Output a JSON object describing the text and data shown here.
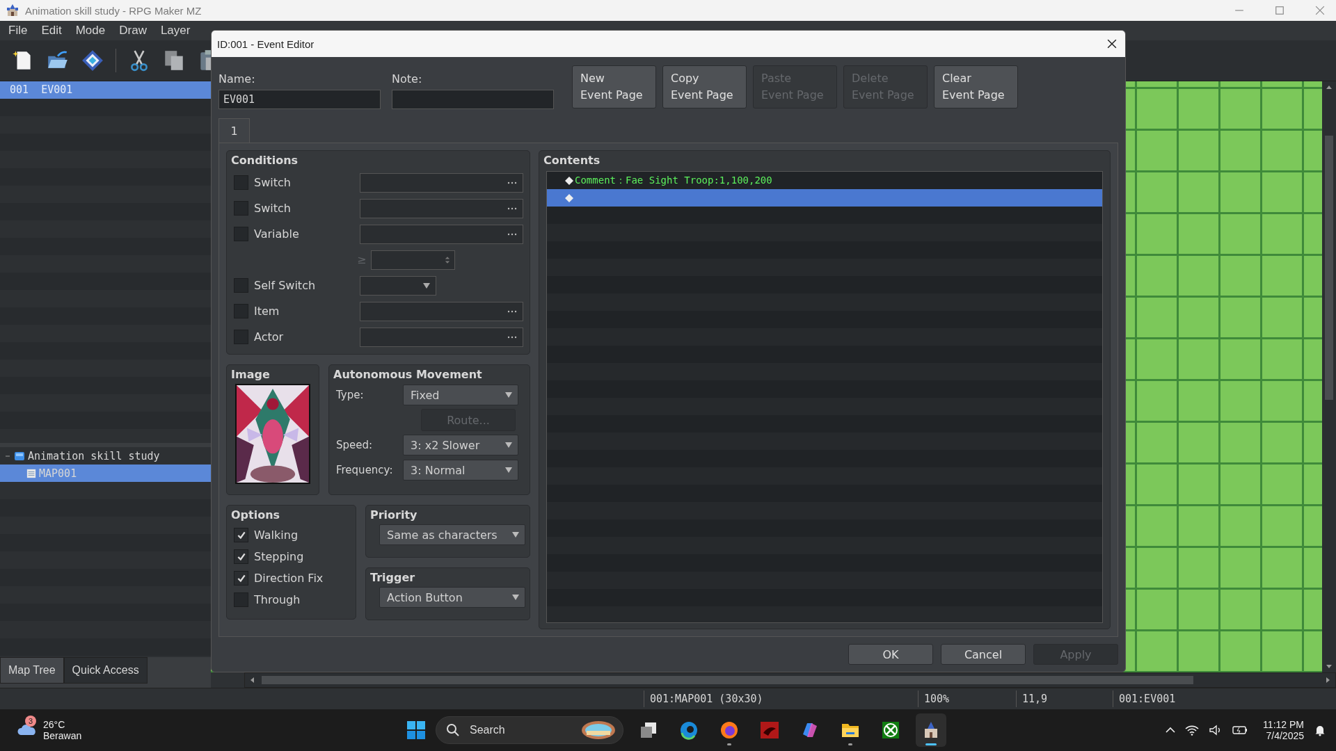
{
  "window": {
    "title": "Animation skill study - RPG Maker MZ"
  },
  "menu": [
    "File",
    "Edit",
    "Mode",
    "Draw",
    "Layer"
  ],
  "event_list": [
    {
      "label": "001  EV001",
      "selected": true
    }
  ],
  "map_tree": [
    {
      "label": "Animation skill study",
      "expanded": true,
      "selected": false,
      "children": [
        {
          "label": "MAP001",
          "selected": true
        }
      ]
    }
  ],
  "panel_tabs": [
    {
      "label": "Map Tree",
      "selected": true
    },
    {
      "label": "Quick Access",
      "selected": false
    }
  ],
  "status_bar": [
    "001:MAP001 (30x30)",
    "100%",
    "11,9",
    "001:EV001"
  ],
  "dialog": {
    "title": "ID:001 - Event Editor",
    "name_label": "Name:",
    "name_value": "EV001",
    "note_label": "Note:",
    "page_buttons": [
      {
        "lines": [
          "New",
          "Event Page"
        ],
        "disabled": false
      },
      {
        "lines": [
          "Copy",
          "Event Page"
        ],
        "disabled": false
      },
      {
        "lines": [
          "Paste",
          "Event Page"
        ],
        "disabled": true
      },
      {
        "lines": [
          "Delete",
          "Event Page"
        ],
        "disabled": true
      },
      {
        "lines": [
          "Clear",
          "Event Page"
        ],
        "disabled": false
      }
    ],
    "page_tabs": [
      {
        "label": "1",
        "selected": true
      }
    ],
    "conditions": {
      "title": "Conditions",
      "rows": [
        {
          "kind": "ref",
          "label": "Switch",
          "checked": false
        },
        {
          "kind": "ref",
          "label": "Switch",
          "checked": false
        },
        {
          "kind": "ref",
          "label": "Variable",
          "checked": false
        },
        {
          "kind": "compare",
          "symbol": "≥"
        },
        {
          "kind": "choice",
          "label": "Self Switch",
          "checked": false
        },
        {
          "kind": "ref",
          "label": "Item",
          "checked": false
        },
        {
          "kind": "ref",
          "label": "Actor",
          "checked": false
        }
      ]
    },
    "image": {
      "title": "Image",
      "kind": "picture"
    },
    "movement": {
      "title": "Autonomous Movement",
      "fields": [
        {
          "kind": "dropdown",
          "label": "Type:",
          "value": "Fixed"
        },
        {
          "kind": "button",
          "label": "Route...",
          "disabled": true
        },
        {
          "kind": "dropdown",
          "label": "Speed:",
          "value": "3: x2 Slower"
        },
        {
          "kind": "dropdown",
          "label": "Frequency:",
          "value": "3: Normal"
        }
      ]
    },
    "options": {
      "title": "Options",
      "items": [
        {
          "label": "Walking",
          "checked": true
        },
        {
          "label": "Stepping",
          "checked": true
        },
        {
          "label": "Direction Fix",
          "checked": true
        },
        {
          "label": "Through",
          "checked": false
        }
      ]
    },
    "priority": {
      "title": "Priority",
      "value": "Same as characters"
    },
    "trigger": {
      "title": "Trigger",
      "value": "Action Button"
    },
    "contents": {
      "title": "Contents",
      "lines": [
        {
          "text": "Comment：Fae Sight Troop:1,100,200",
          "selected": false
        },
        {
          "selected": true
        }
      ]
    },
    "buttons": [
      {
        "label": "OK",
        "disabled": false
      },
      {
        "label": "Cancel",
        "disabled": false
      },
      {
        "label": "Apply",
        "disabled": true
      }
    ]
  },
  "taskbar": {
    "weather": {
      "badge": "3",
      "temperature": "26°C",
      "condition": "Berawan"
    },
    "search": {
      "placeholder": "Search"
    },
    "apps": [
      {
        "running": false,
        "focused": false
      },
      {
        "running": false,
        "focused": false
      },
      {
        "running": true,
        "focused": false
      },
      {
        "running": false,
        "focused": false
      },
      {
        "running": false,
        "focused": false
      },
      {
        "running": true,
        "focused": false
      },
      {
        "running": false,
        "focused": false
      },
      {
        "running": true,
        "focused": true
      }
    ],
    "time": "11:12 PM",
    "date": "7/4/2025"
  }
}
